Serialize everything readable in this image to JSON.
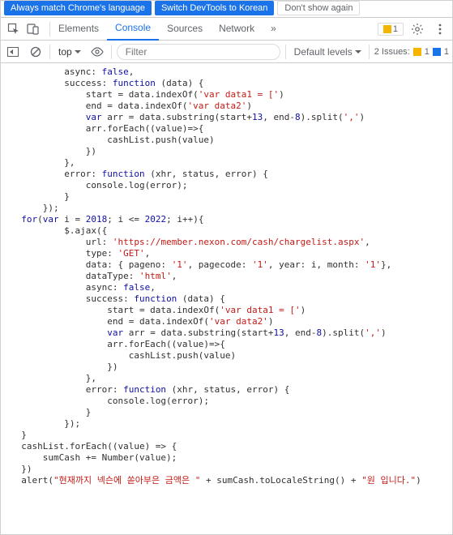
{
  "banner": {
    "btn1": "Always match Chrome's language",
    "btn2": "Switch DevTools to Korean",
    "dismiss": "Don't show again"
  },
  "tabs": {
    "elements": "Elements",
    "console": "Console",
    "sources": "Sources",
    "network": "Network",
    "more": "»",
    "warn_count": "1"
  },
  "toolbar": {
    "context": "top",
    "filter_placeholder": "Filter",
    "levels": "Default levels",
    "issues_label": "2 Issues:",
    "issues_warn": "1",
    "issues_info": "1"
  },
  "code": {
    "lines": [
      {
        "indent": 10,
        "tokens": [
          {
            "t": "async: ",
            "c": ""
          },
          {
            "t": "false",
            "c": "bool"
          },
          {
            "t": ",",
            "c": ""
          }
        ]
      },
      {
        "indent": 10,
        "tokens": [
          {
            "t": "success: ",
            "c": ""
          },
          {
            "t": "function",
            "c": "kw"
          },
          {
            "t": " (data) {",
            "c": ""
          }
        ]
      },
      {
        "indent": 14,
        "tokens": [
          {
            "t": "start = data.indexOf(",
            "c": ""
          },
          {
            "t": "'var data1 = ['",
            "c": "str"
          },
          {
            "t": ")",
            "c": ""
          }
        ]
      },
      {
        "indent": 14,
        "tokens": [
          {
            "t": "end = data.indexOf(",
            "c": ""
          },
          {
            "t": "'var data2'",
            "c": "str"
          },
          {
            "t": ")",
            "c": ""
          }
        ]
      },
      {
        "indent": 14,
        "tokens": [
          {
            "t": "var",
            "c": "kw"
          },
          {
            "t": " arr = data.substring(start+",
            "c": ""
          },
          {
            "t": "13",
            "c": "num"
          },
          {
            "t": ", end-",
            "c": ""
          },
          {
            "t": "8",
            "c": "num"
          },
          {
            "t": ").split(",
            "c": ""
          },
          {
            "t": "','",
            "c": "str"
          },
          {
            "t": ")",
            "c": ""
          }
        ]
      },
      {
        "indent": 14,
        "tokens": [
          {
            "t": "arr.forEach((value)=>{",
            "c": ""
          }
        ]
      },
      {
        "indent": 18,
        "tokens": [
          {
            "t": "cashList.push(value)",
            "c": ""
          }
        ]
      },
      {
        "indent": 14,
        "tokens": [
          {
            "t": "})",
            "c": ""
          }
        ]
      },
      {
        "indent": 10,
        "tokens": [
          {
            "t": "},",
            "c": ""
          }
        ]
      },
      {
        "indent": 10,
        "tokens": [
          {
            "t": "error: ",
            "c": ""
          },
          {
            "t": "function",
            "c": "kw"
          },
          {
            "t": " (xhr, status, error) {",
            "c": ""
          }
        ]
      },
      {
        "indent": 14,
        "tokens": [
          {
            "t": "console.log(error);",
            "c": ""
          }
        ]
      },
      {
        "indent": 10,
        "tokens": [
          {
            "t": "}",
            "c": ""
          }
        ]
      },
      {
        "indent": 6,
        "tokens": [
          {
            "t": "});",
            "c": ""
          }
        ]
      },
      {
        "indent": 2,
        "tokens": [
          {
            "t": "for",
            "c": "kw"
          },
          {
            "t": "(",
            "c": ""
          },
          {
            "t": "var",
            "c": "kw"
          },
          {
            "t": " i = ",
            "c": ""
          },
          {
            "t": "2018",
            "c": "num"
          },
          {
            "t": "; i <= ",
            "c": ""
          },
          {
            "t": "2022",
            "c": "num"
          },
          {
            "t": "; i++){",
            "c": ""
          }
        ]
      },
      {
        "indent": 10,
        "tokens": [
          {
            "t": "$.ajax({",
            "c": ""
          }
        ]
      },
      {
        "indent": 14,
        "tokens": [
          {
            "t": "url: ",
            "c": ""
          },
          {
            "t": "'https://member.nexon.com/cash/chargelist.aspx'",
            "c": "str"
          },
          {
            "t": ",",
            "c": ""
          }
        ]
      },
      {
        "indent": 14,
        "tokens": [
          {
            "t": "type: ",
            "c": ""
          },
          {
            "t": "'GET'",
            "c": "str"
          },
          {
            "t": ",",
            "c": ""
          }
        ]
      },
      {
        "indent": 14,
        "tokens": [
          {
            "t": "data: { pageno: ",
            "c": ""
          },
          {
            "t": "'1'",
            "c": "str"
          },
          {
            "t": ", pagecode: ",
            "c": ""
          },
          {
            "t": "'1'",
            "c": "str"
          },
          {
            "t": ", year: i, month: ",
            "c": ""
          },
          {
            "t": "'1'",
            "c": "str"
          },
          {
            "t": "},",
            "c": ""
          }
        ]
      },
      {
        "indent": 14,
        "tokens": [
          {
            "t": "dataType: ",
            "c": ""
          },
          {
            "t": "'html'",
            "c": "str"
          },
          {
            "t": ",",
            "c": ""
          }
        ]
      },
      {
        "indent": 14,
        "tokens": [
          {
            "t": "async: ",
            "c": ""
          },
          {
            "t": "false",
            "c": "bool"
          },
          {
            "t": ",",
            "c": ""
          }
        ]
      },
      {
        "indent": 14,
        "tokens": [
          {
            "t": "success: ",
            "c": ""
          },
          {
            "t": "function",
            "c": "kw"
          },
          {
            "t": " (data) {",
            "c": ""
          }
        ]
      },
      {
        "indent": 18,
        "tokens": [
          {
            "t": "start = data.indexOf(",
            "c": ""
          },
          {
            "t": "'var data1 = ['",
            "c": "str"
          },
          {
            "t": ")",
            "c": ""
          }
        ]
      },
      {
        "indent": 18,
        "tokens": [
          {
            "t": "end = data.indexOf(",
            "c": ""
          },
          {
            "t": "'var data2'",
            "c": "str"
          },
          {
            "t": ")",
            "c": ""
          }
        ]
      },
      {
        "indent": 18,
        "tokens": [
          {
            "t": "var",
            "c": "kw"
          },
          {
            "t": " arr = data.substring(start+",
            "c": ""
          },
          {
            "t": "13",
            "c": "num"
          },
          {
            "t": ", end-",
            "c": ""
          },
          {
            "t": "8",
            "c": "num"
          },
          {
            "t": ").split(",
            "c": ""
          },
          {
            "t": "','",
            "c": "str"
          },
          {
            "t": ")",
            "c": ""
          }
        ]
      },
      {
        "indent": 18,
        "tokens": [
          {
            "t": "arr.forEach((value)=>{",
            "c": ""
          }
        ]
      },
      {
        "indent": 22,
        "tokens": [
          {
            "t": "cashList.push(value)",
            "c": ""
          }
        ]
      },
      {
        "indent": 18,
        "tokens": [
          {
            "t": "})",
            "c": ""
          }
        ]
      },
      {
        "indent": 14,
        "tokens": [
          {
            "t": "},",
            "c": ""
          }
        ]
      },
      {
        "indent": 14,
        "tokens": [
          {
            "t": "error: ",
            "c": ""
          },
          {
            "t": "function",
            "c": "kw"
          },
          {
            "t": " (xhr, status, error) {",
            "c": ""
          }
        ]
      },
      {
        "indent": 18,
        "tokens": [
          {
            "t": "console.log(error);",
            "c": ""
          }
        ]
      },
      {
        "indent": 14,
        "tokens": [
          {
            "t": "}",
            "c": ""
          }
        ]
      },
      {
        "indent": 10,
        "tokens": [
          {
            "t": "});",
            "c": ""
          }
        ]
      },
      {
        "indent": 2,
        "tokens": [
          {
            "t": "}",
            "c": ""
          }
        ]
      },
      {
        "indent": 0,
        "tokens": [
          {
            "t": "",
            "c": ""
          }
        ]
      },
      {
        "indent": 2,
        "tokens": [
          {
            "t": "cashList.forEach((value) => {",
            "c": ""
          }
        ]
      },
      {
        "indent": 6,
        "tokens": [
          {
            "t": "sumCash += Number(value);",
            "c": ""
          }
        ]
      },
      {
        "indent": 2,
        "tokens": [
          {
            "t": "})",
            "c": ""
          }
        ]
      },
      {
        "indent": 0,
        "tokens": [
          {
            "t": "",
            "c": ""
          }
        ]
      },
      {
        "indent": 2,
        "tokens": [
          {
            "t": "alert(",
            "c": ""
          },
          {
            "t": "\"현재까지 넥슨에 쏟아부은 금액은 \"",
            "c": "str"
          },
          {
            "t": " + sumCash.toLocaleString() + ",
            "c": ""
          },
          {
            "t": "\"원 입니다.\"",
            "c": "str"
          },
          {
            "t": ")",
            "c": ""
          }
        ]
      }
    ]
  }
}
